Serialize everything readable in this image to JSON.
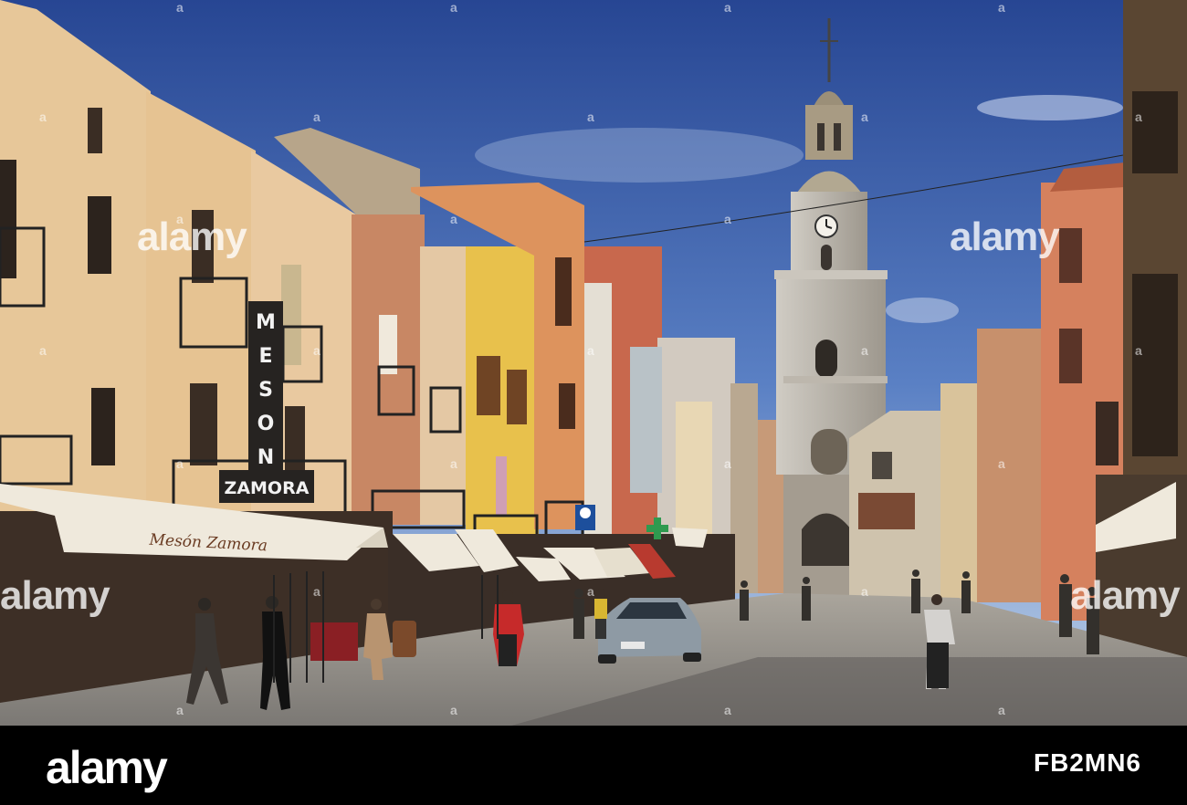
{
  "photo": {
    "sign_top": "MESON",
    "sign_bottom": "ZAMORA",
    "awning_text": "Mesón Zamora",
    "car_plate": "",
    "colors": {
      "sky_top": "#2f4f9a",
      "sky_bottom": "#7d9fd0",
      "tower_stone": "#b8b3aa",
      "street": "#8f8c88"
    }
  },
  "watermarks": {
    "mark_a": "a",
    "big_left": "alamy",
    "big_right": "alamy"
  },
  "footer": {
    "logo": "alamy",
    "image_id": "FB2MN6"
  }
}
